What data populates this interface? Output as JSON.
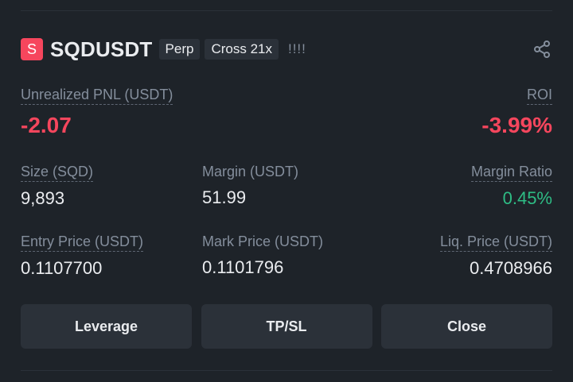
{
  "position": {
    "coin_letter": "S",
    "symbol": "SQDUSDT",
    "tags": [
      "Perp",
      "Cross 21x"
    ],
    "warning": "!!!!",
    "share_icon": "share-icon"
  },
  "pnl": {
    "label": "Unrealized PNL (USDT)",
    "value": "-2.07"
  },
  "roi": {
    "label": "ROI",
    "value": "-3.99%"
  },
  "size": {
    "label": "Size (SQD)",
    "value": "9,893"
  },
  "margin": {
    "label": "Margin (USDT)",
    "value": "51.99"
  },
  "margin_ratio": {
    "label": "Margin Ratio",
    "value": "0.45%"
  },
  "entry_price": {
    "label": "Entry Price (USDT)",
    "value": "0.1107700"
  },
  "mark_price": {
    "label": "Mark Price (USDT)",
    "value": "0.1101796"
  },
  "liq_price": {
    "label": "Liq. Price (USDT)",
    "value": "0.4708966"
  },
  "actions": {
    "leverage": "Leverage",
    "tpsl": "TP/SL",
    "close": "Close"
  },
  "colors": {
    "background": "#1e2329",
    "negative": "#f6465d",
    "positive": "#2ebd85",
    "muted": "#848e9c",
    "button": "#2b3139"
  }
}
